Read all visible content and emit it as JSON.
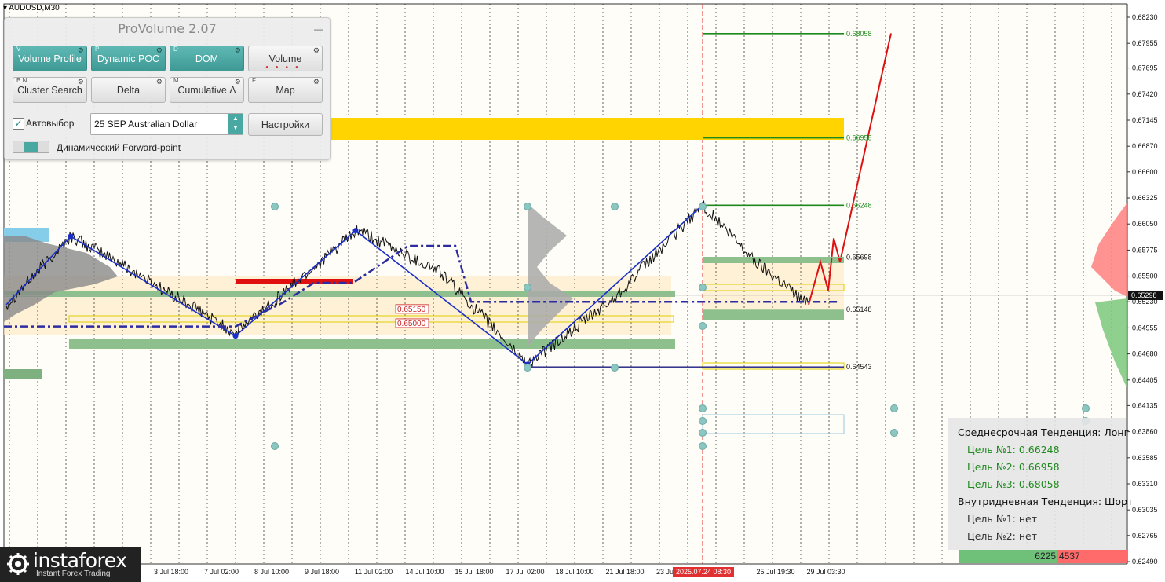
{
  "window": {
    "symbol": "AUDUSD,M30"
  },
  "price_axis": {
    "ticks": [
      "0.68230",
      "0.67955",
      "0.67695",
      "0.67420",
      "0.67145",
      "0.66870",
      "0.66600",
      "0.66325",
      "0.66050",
      "0.65775",
      "0.65500",
      "0.65230",
      "0.64955",
      "0.64680",
      "0.64405",
      "0.64135",
      "0.63860",
      "0.63585",
      "0.63310",
      "0.63035",
      "0.62765",
      "0.62490"
    ],
    "current": "0.65298"
  },
  "time_axis": {
    "ticks": [
      "3 Jul 18:00",
      "7 Jul 02:00",
      "8 Jul 10:00",
      "9 Jul 18:00",
      "11 Jul 02:00",
      "14 Jul 10:00",
      "15 Jul 18:00",
      "17 Jul 02:00",
      "18 Jul 10:00",
      "21 Jul 18:00",
      "23 Jul",
      "25 Jul 19:30",
      "29 Jul 03:30"
    ],
    "highlight": "2025.07.24 08:30"
  },
  "levels": [
    "0.68058",
    "0.66958",
    "0.66248",
    "0.65698",
    "0.65148",
    "0.64543"
  ],
  "markers": [
    "0.65150",
    "0.65000"
  ],
  "panel": {
    "title": "ProVolume 2.07",
    "buttons": [
      {
        "label": "Volume Profile",
        "key": "V",
        "on": true
      },
      {
        "label": "Dynamic POC",
        "key": "P",
        "on": true
      },
      {
        "label": "DOM",
        "key": "D",
        "on": true
      },
      {
        "label": "Volume",
        "key": "",
        "on": false
      },
      {
        "label": "Cluster Search",
        "key": "B N",
        "on": false
      },
      {
        "label": "Delta",
        "key": "",
        "on": false
      },
      {
        "label": "Cumulative Δ",
        "key": "M",
        "on": false
      },
      {
        "label": "Map",
        "key": "F",
        "on": false
      }
    ],
    "auto_select_label": "Автовыбор",
    "instrument": "25 SEP Australian Dollar",
    "settings_label": "Настройки",
    "forward_label": "Динамический Forward-point"
  },
  "trend": {
    "medium_label": "Среднесрочная Тенденция: Лонг",
    "target1": "Цель №1: 0.66248",
    "target2": "Цель №2: 0.66958",
    "target3": "Цель №3: 0.68058",
    "intraday_label": "Внутридневная Тенденция: Шорт",
    "intraday_target1": "Цель №1: нет",
    "intraday_target2": "Цель №2: нет"
  },
  "volume": {
    "buy": "6225",
    "sell": "4537"
  },
  "logo": {
    "name": "instaforex",
    "tagline": "Instant Forex Trading"
  },
  "colors": {
    "accent": "#4aa8a3",
    "level_green": "#1e8a1e",
    "target_red": "#dd1111",
    "zigzag": "#1a2fc8",
    "gold_zone": "#ffd400"
  }
}
